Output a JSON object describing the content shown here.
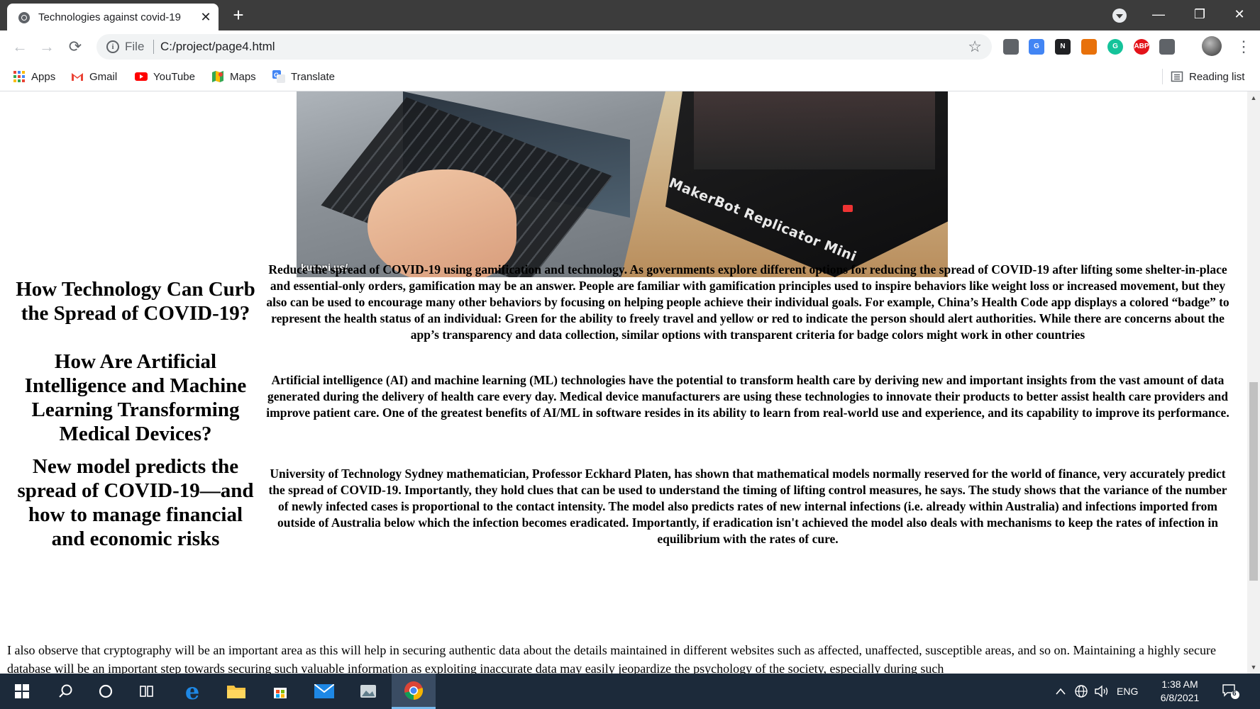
{
  "browser": {
    "tab_title": "Technologies against covid-19",
    "new_tab_label": "+",
    "url_scheme": "File",
    "url": "C:/project/page4.html",
    "window_controls": {
      "minimize": "—",
      "restore": "❐",
      "close": "✕"
    }
  },
  "bookmarks": [
    {
      "label": "Apps",
      "icon": "apps-icon"
    },
    {
      "label": "Gmail",
      "icon": "gmail-icon"
    },
    {
      "label": "YouTube",
      "icon": "youtube-icon"
    },
    {
      "label": "Maps",
      "icon": "maps-icon"
    },
    {
      "label": "Translate",
      "icon": "translate-icon"
    }
  ],
  "reading_list": "Reading list",
  "extensions": [
    {
      "name": "extension-icon",
      "text": "",
      "color": "#5f6368"
    },
    {
      "name": "google-translate-icon",
      "text": "G",
      "color": "#4285f4"
    },
    {
      "name": "notion-icon",
      "text": "N",
      "color": "#202124"
    },
    {
      "name": "cast-icon",
      "text": "",
      "color": "#e8710a"
    },
    {
      "name": "grammarly-icon",
      "text": "G",
      "color": "#15c39a"
    },
    {
      "name": "adblock-plus-icon",
      "text": "ABP",
      "color": "#e3131a"
    },
    {
      "name": "puzzle-icon",
      "text": "",
      "color": "#5f6368"
    }
  ],
  "hero_image": {
    "watermark": "kurani.us/",
    "printer_label": "MakerBot Replicator Mini"
  },
  "sections": [
    {
      "heading": "How Technology Can Curb the Spread of COVID-19?",
      "body": "Reduce the spread of COVID-19 using gamification and technology. As governments explore different options for reducing the spread of COVID-19 after lifting some shelter-in-place and essential-only orders, gamification may be an answer. People are familiar with gamification principles used to inspire behaviors like weight loss or increased movement, but they also can be used to encourage many other behaviors by focusing on helping people achieve their individual goals. For example, China’s Health Code app displays a colored “badge” to represent the health status of an individual: Green for the ability to freely travel and yellow or red to indicate the person should alert authorities. While there are concerns about the app’s transparency and data collection, similar options with transparent criteria for badge colors might work in other countries"
    },
    {
      "heading": "How Are Artificial Intelligence and Machine Learning Transforming Medical Devices?",
      "body": "Artificial intelligence (AI) and machine learning (ML) technologies have the potential to transform health care by deriving new and important insights from the vast amount of data generated during the delivery of health care every day. Medical device manufacturers are using these technologies to innovate their products to better assist health care providers and improve patient care. One of the greatest benefits of AI/ML in software resides in its ability to learn from real-world use and experience, and its capability to improve its performance."
    },
    {
      "heading": "New model predicts the spread of COVID-19—and how to manage financial and economic risks",
      "body": "University of Technology Sydney mathematician, Professor Eckhard Platen, has shown that mathematical models normally reserved for the world of finance, very accurately predict the spread of COVID-19. Importantly, they hold clues that can be used to understand the timing of lifting control measures, he says. The study shows that the variance of the number of newly infected cases is proportional to the contact intensity. The model also predicts rates of new internal infections (i.e. already within Australia) and infections imported from outside of Australia below which the infection becomes eradicated. Importantly, if eradication isn't achieved the model also deals with mechanisms to keep the rates of infection in equilibrium with the rates of cure."
    }
  ],
  "closing_paragraph": "I also observe that cryptography will be an important area as this will help in securing authentic data about the details maintained in different websites such as affected, unaffected, susceptible areas, and so on. Maintaining a highly secure database will be an important step towards securing such valuable information as exploiting inaccurate data may easily jeopardize the psychology of the society, especially during such",
  "taskbar": {
    "language": "ENG",
    "time": "1:38 AM",
    "date": "6/8/2021",
    "notifications": "6"
  }
}
